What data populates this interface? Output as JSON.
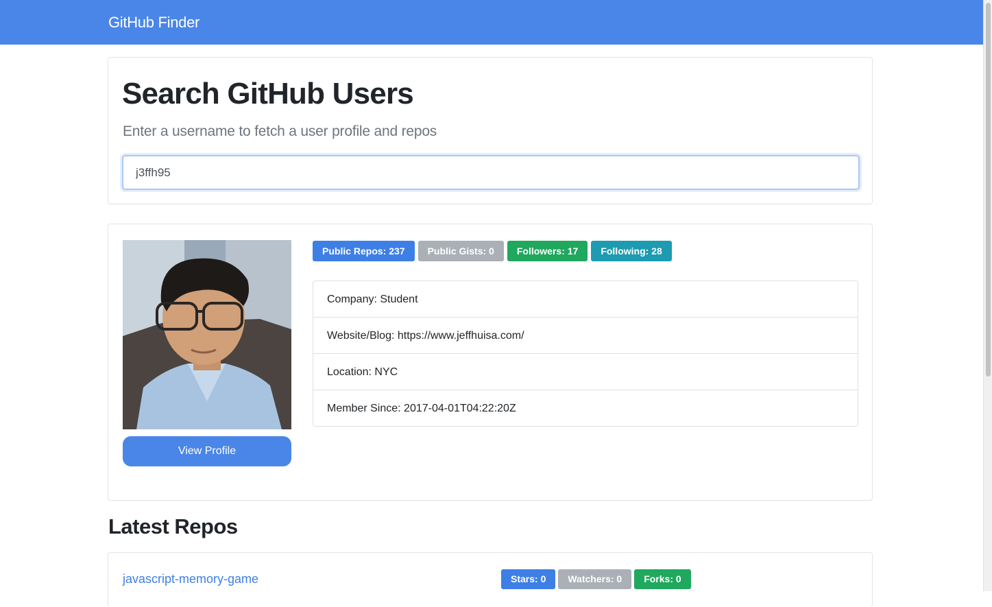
{
  "navbar": {
    "brand": "GitHub Finder"
  },
  "search": {
    "title": "Search GitHub Users",
    "lead": "Enter a username to fetch a user profile and repos",
    "input_value": "j3ffh95"
  },
  "profile": {
    "avatar_alt": "user avatar",
    "view_profile_label": "View Profile",
    "badges": {
      "public_repos": "Public Repos: 237",
      "public_gists": "Public Gists: 0",
      "followers": "Followers: 17",
      "following": "Following: 28"
    },
    "info": {
      "company": "Company: Student",
      "website": "Website/Blog: https://www.jeffhuisa.com/",
      "location": "Location: NYC",
      "member_since": "Member Since: 2017-04-01T04:22:20Z"
    }
  },
  "repos": {
    "heading": "Latest Repos",
    "items": [
      {
        "name": "javascript-memory-game",
        "stars": "Stars: 0",
        "watchers": "Watchers: 0",
        "forks": "Forks: 0"
      }
    ]
  },
  "colors": {
    "primary": "#4a86e8",
    "secondary": "#aab0b6",
    "success": "#1fa85e",
    "info": "#1d9bb1"
  }
}
